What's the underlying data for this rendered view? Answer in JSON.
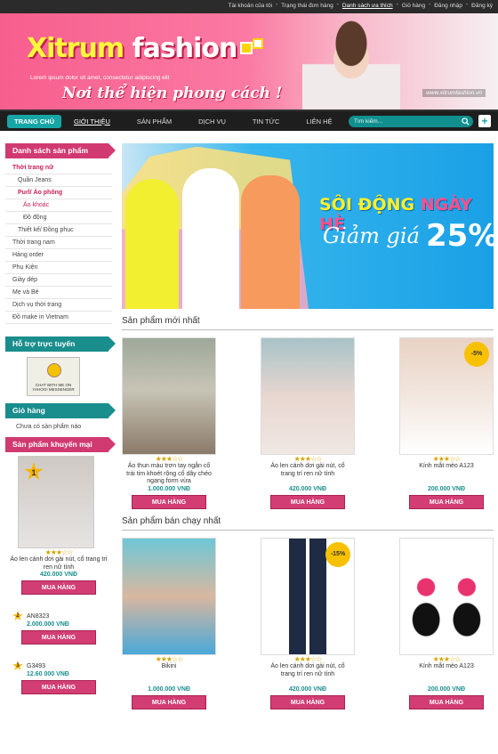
{
  "topbar": {
    "links": [
      "Tài khoản của tôi",
      "Trạng thái đơn hàng",
      "Danh sách ưa thích",
      "Giỏ hàng",
      "Đăng nhập",
      "Đăng ký"
    ]
  },
  "header": {
    "logo_brand": "Xitrum",
    "logo_word": "fashion",
    "tagline_sub": "Lorem ipsum dolor sit amet, consectetur adipiscing elit",
    "slogan": "Nơi thể hiện phong cách !",
    "url": "www.xitrumfashion.vn"
  },
  "nav": {
    "items": [
      "TRANG CHỦ",
      "GIỚI THIỆU",
      "SẢN PHẨM",
      "DỊCH VỤ",
      "TIN TỨC",
      "LIÊN HỆ"
    ],
    "search_placeholder": "Tìm kiếm..."
  },
  "sidebar": {
    "categories_title": "Danh sách sản phẩm",
    "categories": [
      "Thời trang nữ",
      "Quần Jeans",
      "Purl/ Áo phông",
      "Áo khoác",
      "Đồ động",
      "Thiết kế/ Đồng phục",
      "Thời trang nam",
      "Hàng order",
      "Phụ Kiện",
      "Giày dép",
      "Mẹ và Bé",
      "Dịch vụ thời trang",
      "Đồ make in Vietnam"
    ],
    "support_title": "Hỗ trợ trực tuyến",
    "support_label": "CHAT WITH ME ON YAHOO! MESSENGER",
    "cart_title": "Giỏ hàng",
    "cart_empty": "Chưa có sản phẩm nào",
    "promo_title": "Sản phẩm khuyến mại",
    "promo_product": {
      "rank": "1",
      "name": "Áo len cánh dơi gài nút, cổ trang trí ren nữ tính",
      "price": "420.000 VNĐ",
      "buy": "MUA HÀNG"
    },
    "ranked": [
      {
        "rank": "2",
        "code": "AN8323",
        "price": "2.000.000 VNĐ",
        "buy": "MUA HÀNG"
      },
      {
        "rank": "3",
        "code": "G3493",
        "price": "12.60 000 VNĐ",
        "buy": "MUA HÀNG"
      }
    ]
  },
  "banner": {
    "title_a": "SÔI ĐỘNG",
    "title_b": "NGÀY HÈ",
    "sale": "Giảm giá",
    "percent": "25%"
  },
  "new_products": {
    "title": "Sản phẩm mới nhất",
    "items": [
      {
        "name": "Áo thun màu trơn tay ngắn cổ trái tim khoét rộng cổ dây chéo ngang form vừa",
        "price": "1.000.000 VNĐ",
        "buy": "MUA HÀNG",
        "badge": ""
      },
      {
        "name": "Áo len cánh dơi gài nút, cổ trang trí ren nữ tính",
        "price": "420.000 VNĐ",
        "buy": "MUA HÀNG",
        "badge": ""
      },
      {
        "name": "Kính mắt mèo A123",
        "price": "200.000 VNĐ",
        "buy": "MUA HÀNG",
        "badge": "-5%"
      }
    ]
  },
  "best_sellers": {
    "title": "Sản phẩm bán chạy nhất",
    "items": [
      {
        "name": "Bikini",
        "price": "1.000.000 VNĐ",
        "buy": "MUA HÀNG",
        "badge": ""
      },
      {
        "name": "Áo len cánh dơi gài nút, cổ trang trí ren nữ tính",
        "price": "420.000 VNĐ",
        "buy": "MUA HÀNG",
        "badge": "-15%"
      },
      {
        "name": "Kính mắt mèo A123",
        "price": "200.000 VNĐ",
        "buy": "MUA HÀNG",
        "badge": ""
      }
    ]
  },
  "colors": {
    "pink": "#d23d73",
    "teal": "#1a8d8d",
    "dark": "#1e1e1e"
  }
}
